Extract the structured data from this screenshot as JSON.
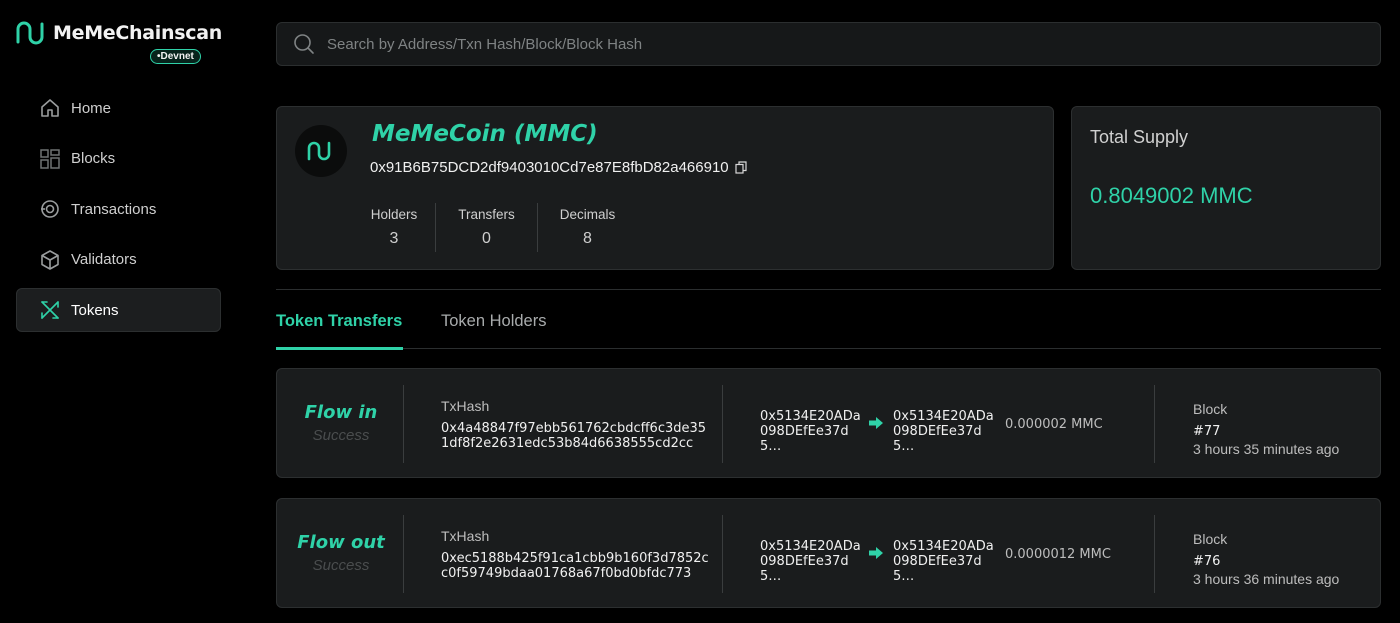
{
  "brand": {
    "name": "MeMeChainscan",
    "badge": "Devnet"
  },
  "colors": {
    "accent": "#2fd2a8",
    "background": "#000000",
    "card": "#1a1c1d"
  },
  "nav": {
    "items": [
      {
        "label": "Home",
        "icon": "home-icon"
      },
      {
        "label": "Blocks",
        "icon": "blocks-icon"
      },
      {
        "label": "Transactions",
        "icon": "transactions-icon"
      },
      {
        "label": "Validators",
        "icon": "validators-icon"
      },
      {
        "label": "Tokens",
        "icon": "tokens-icon",
        "active": true
      }
    ]
  },
  "search": {
    "placeholder": "Search by Address/Txn Hash/Block/Block Hash",
    "value": ""
  },
  "token": {
    "name": "MeMeCoin (MMC)",
    "address": "0x91B6B75DCD2df9403010Cd7e87E8fbD82a466910",
    "stats": [
      {
        "label": "Holders",
        "value": "3"
      },
      {
        "label": "Transfers",
        "value": "0"
      },
      {
        "label": "Decimals",
        "value": "8"
      }
    ]
  },
  "supply": {
    "label": "Total Supply",
    "value": "0.8049002 MMC"
  },
  "tabs": {
    "transfers": "Token Transfers",
    "holders": "Token Holders",
    "active": "transfers"
  },
  "transfers": [
    {
      "direction": "Flow in",
      "status": "Success",
      "tx_label": "TxHash",
      "tx_hash": "0x4a48847f97ebb561762cbdcff6c3de351df8f2e2631edc53b84d6638555cd2cc",
      "from": "0x5134E20ADa098DEfEe37d5…",
      "to": "0x5134E20ADa098DEfEe37d5…",
      "amount": "0.000002 MMC",
      "block_label": "Block",
      "block": "#77",
      "time": "3 hours 35 minutes ago"
    },
    {
      "direction": "Flow out",
      "status": "Success",
      "tx_label": "TxHash",
      "tx_hash": "0xec5188b425f91ca1cbb9b160f3d7852cc0f59749bdaa01768a67f0bd0bfdc773",
      "from": "0x5134E20ADa098DEfEe37d5…",
      "to": "0x5134E20ADa098DEfEe37d5…",
      "amount": "0.0000012 MMC",
      "block_label": "Block",
      "block": "#76",
      "time": "3 hours 36 minutes ago"
    }
  ]
}
